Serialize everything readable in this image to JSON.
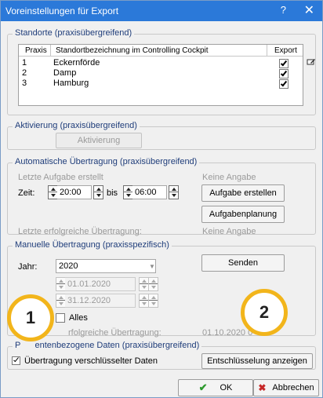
{
  "window": {
    "title": "Voreinstellungen für Export",
    "help": "?",
    "close": "✕"
  },
  "standorte": {
    "legend": "Standorte (praxisübergreifend)",
    "headers": [
      "Praxis",
      "Standortbezeichnung im Controlling Cockpit",
      "Export"
    ],
    "rows": [
      {
        "praxis": "1",
        "name": "Eckernförde",
        "export": true
      },
      {
        "praxis": "2",
        "name": "Damp",
        "export": true
      },
      {
        "praxis": "3",
        "name": "Hamburg",
        "export": true
      }
    ],
    "side_icon": "edit-icon"
  },
  "aktivierung": {
    "legend": "Aktivierung (praxisübergreifend)",
    "button": "Aktivierung"
  },
  "auto": {
    "legend": "Automatische Übertragung (praxisübergreifend)",
    "last_task_label": "Letzte Aufgabe erstellt",
    "last_task_value": "Keine Angabe",
    "zeit_label": "Zeit:",
    "from": "20:00",
    "bis_label": "bis",
    "to": "06:00",
    "btn_create": "Aufgabe erstellen",
    "btn_plan": "Aufgabenplanung",
    "last_success_label": "Letzte erfolgreiche Übertragung:",
    "last_success_value": "Keine Angabe"
  },
  "manual": {
    "legend": "Manuelle Übertragung (praxisspezifisch)",
    "jahr_label": "Jahr:",
    "jahr_value": "2020",
    "btn_send": "Senden",
    "date_from": "01.01.2020",
    "date_to": "31.12.2020",
    "alles_label": "Alles",
    "last_success_label": "rfolgreiche Übertragung:",
    "last_success_value": "01.10.2020 0"
  },
  "patient": {
    "legend": "Patientenbezogene Daten (praxisübergreifend)",
    "legend_visible": "P      entenbezogene Daten (praxisübergreifend)",
    "encrypt_label": "Übertragung verschlüsselter Daten",
    "encrypt_checked": true,
    "btn_decrypt": "Entschlüsselung anzeigen"
  },
  "footer": {
    "ok": "OK",
    "cancel": "Abbrechen"
  },
  "badges": [
    "1",
    "2"
  ],
  "colors": {
    "titlebar": "#2b79d9",
    "badge_ring": "#f2b51b",
    "ok_check": "#2e9a2e",
    "cancel_x": "#c62828"
  }
}
